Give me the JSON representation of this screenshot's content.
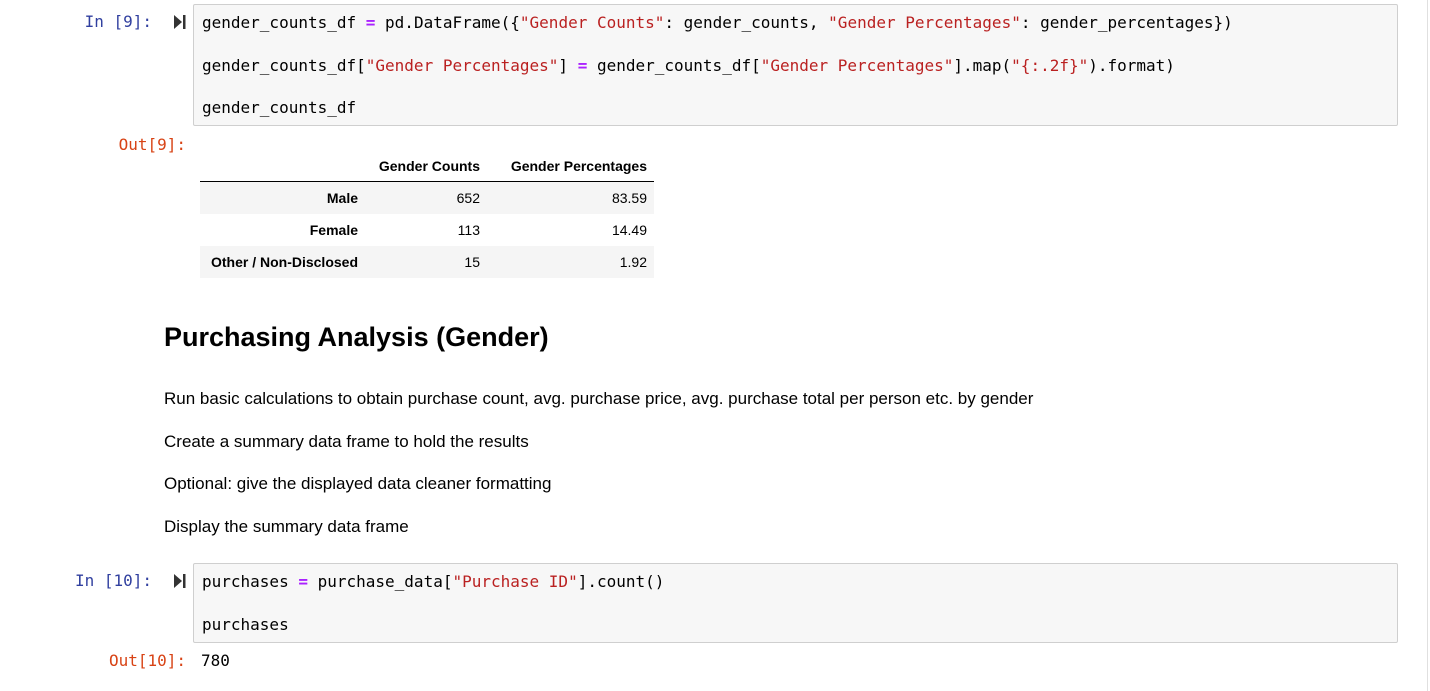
{
  "cells": [
    {
      "prompt": "In [9]:",
      "code": [
        [
          [
            "t",
            "gender_counts_df "
          ],
          [
            "o",
            "="
          ],
          [
            "t",
            " pd.DataFrame({"
          ],
          [
            "s",
            "\"Gender Counts\""
          ],
          [
            "t",
            ": gender_counts, "
          ],
          [
            "s",
            "\"Gender Percentages\""
          ],
          [
            "t",
            ": gender_percentages})"
          ]
        ],
        [
          [
            "t",
            "gender_counts_df["
          ],
          [
            "s",
            "\"Gender Percentages\""
          ],
          [
            "t",
            "] "
          ],
          [
            "o",
            "="
          ],
          [
            "t",
            " gender_counts_df["
          ],
          [
            "s",
            "\"Gender Percentages\""
          ],
          [
            "t",
            "].map("
          ],
          [
            "s",
            "\"{:.2f}\""
          ],
          [
            "t",
            ").format)"
          ]
        ],
        [
          [
            "t",
            "gender_counts_df"
          ]
        ]
      ],
      "output_prompt": "Out[9]:",
      "table": {
        "columns": [
          "Gender Counts",
          "Gender Percentages"
        ],
        "rows": [
          {
            "index": "Male",
            "values": [
              "652",
              "83.59"
            ]
          },
          {
            "index": "Female",
            "values": [
              "113",
              "14.49"
            ]
          },
          {
            "index": "Other / Non-Disclosed",
            "values": [
              "15",
              "1.92"
            ]
          }
        ]
      }
    },
    {
      "prompt": "In [10]:",
      "code": [
        [
          [
            "t",
            "purchases "
          ],
          [
            "o",
            "="
          ],
          [
            "t",
            " purchase_data["
          ],
          [
            "s",
            "\"Purchase ID\""
          ],
          [
            "t",
            "].count()"
          ]
        ],
        [
          [
            "t",
            "purchases"
          ]
        ]
      ],
      "output_prompt": "Out[10]:",
      "output_text": "780"
    }
  ],
  "markdown": {
    "heading": "Purchasing Analysis (Gender)",
    "paragraphs": [
      "Run basic calculations to obtain purchase count, avg. purchase price, avg. purchase total per person etc. by gender",
      "Create a summary data frame to hold the results",
      "Optional: give the displayed data cleaner formatting",
      "Display the summary data frame"
    ]
  },
  "icons": {
    "run": "run-step-icon"
  },
  "colors": {
    "prompt_in": "#303f9f",
    "prompt_out": "#d84315",
    "string": "#ba2121",
    "operator": "#aa22ff"
  }
}
